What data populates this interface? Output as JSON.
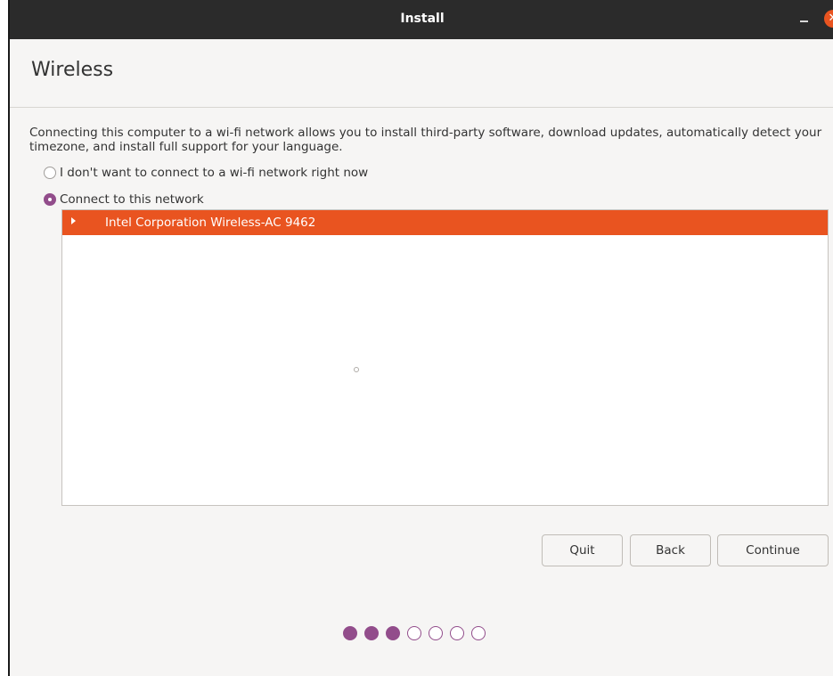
{
  "window": {
    "title": "Install",
    "minimize_icon": "minimize-icon",
    "close_icon": "close-icon",
    "close_glyph": "✕"
  },
  "page": {
    "title": "Wireless",
    "description": "Connecting this computer to a wi-fi network allows you to install third-party software, download updates, automatically detect your timezone, and install full support for your language."
  },
  "options": [
    {
      "label": "I don't want to connect to a wi-fi network right now",
      "selected": false
    },
    {
      "label": "Connect to this network",
      "selected": true
    }
  ],
  "network_list": {
    "items": [
      {
        "label": "Intel Corporation Wireless-AC 9462",
        "expanded": false,
        "selected": true
      }
    ],
    "loading": true
  },
  "buttons": {
    "quit": "Quit",
    "back": "Back",
    "continue": "Continue"
  },
  "progress": {
    "total_steps": 7,
    "completed_steps": 3
  },
  "colors": {
    "accent": "#e95420",
    "aubergine": "#924d8b",
    "titlebar": "#2b2b2b",
    "background": "#f6f5f4"
  }
}
